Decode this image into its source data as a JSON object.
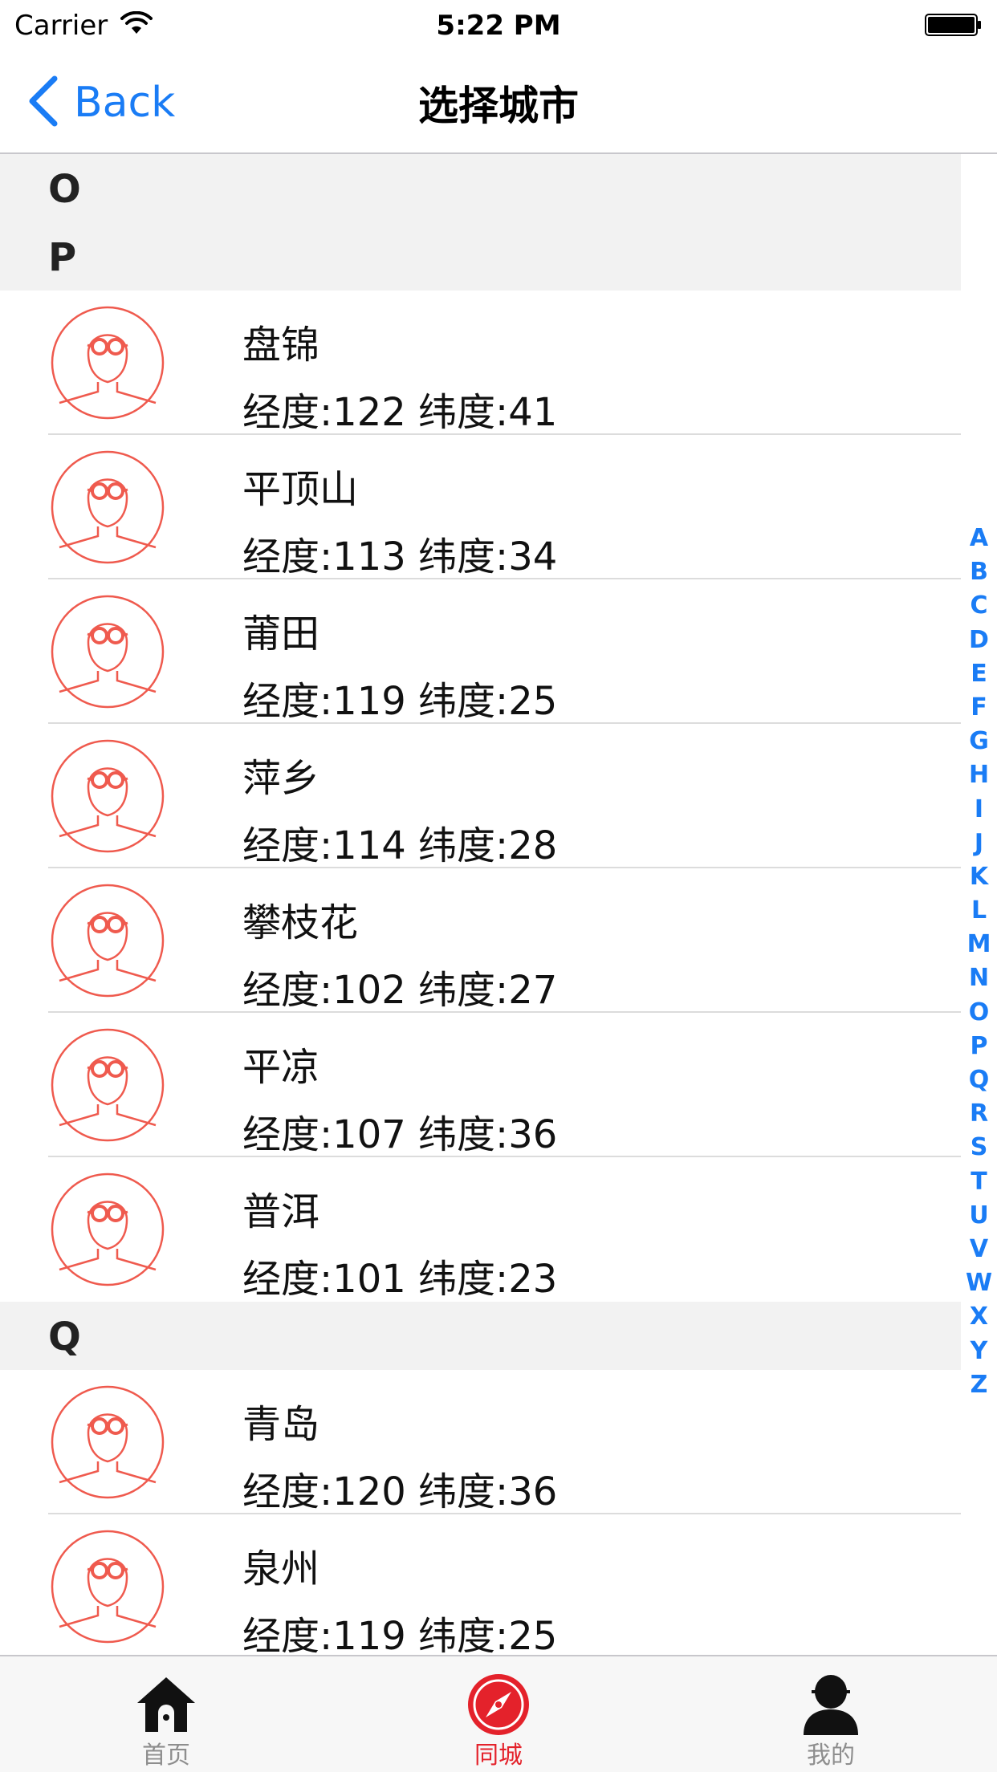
{
  "status_bar": {
    "carrier": "Carrier",
    "time": "5:22 PM"
  },
  "nav": {
    "back_label": "Back",
    "title": "选择城市"
  },
  "colors": {
    "accent": "#1a7cf5",
    "avatar_stroke": "#ef5a4e",
    "active_tab": "#e4222b",
    "section_bg": "#f2f2f2"
  },
  "list": {
    "sections": [
      {
        "letter": "O",
        "cities": []
      },
      {
        "letter": "P",
        "cities": [
          {
            "name": "盘锦",
            "coords": "经度:122 纬度:41",
            "icon": "avatar-glasses-icon"
          },
          {
            "name": "平顶山",
            "coords": "经度:113 纬度:34",
            "icon": "avatar-glasses-icon"
          },
          {
            "name": "莆田",
            "coords": "经度:119 纬度:25",
            "icon": "avatar-glasses-icon"
          },
          {
            "name": "萍乡",
            "coords": "经度:114 纬度:28",
            "icon": "avatar-glasses-icon"
          },
          {
            "name": "攀枝花",
            "coords": "经度:102 纬度:27",
            "icon": "avatar-glasses-icon"
          },
          {
            "name": "平凉",
            "coords": "经度:107 纬度:36",
            "icon": "avatar-glasses-icon"
          },
          {
            "name": "普洱",
            "coords": "经度:101 纬度:23",
            "icon": "avatar-glasses-icon"
          }
        ]
      },
      {
        "letter": "Q",
        "cities": [
          {
            "name": "青岛",
            "coords": "经度:120 纬度:36",
            "icon": "avatar-glasses-icon"
          },
          {
            "name": "泉州",
            "coords": "经度:119 纬度:25",
            "icon": "avatar-glasses-icon"
          }
        ]
      }
    ]
  },
  "index_bar": {
    "letters": [
      "A",
      "B",
      "C",
      "D",
      "E",
      "F",
      "G",
      "H",
      "I",
      "J",
      "K",
      "L",
      "M",
      "N",
      "O",
      "P",
      "Q",
      "R",
      "S",
      "T",
      "U",
      "V",
      "W",
      "X",
      "Y",
      "Z"
    ]
  },
  "tab_bar": {
    "items": [
      {
        "label": "首页",
        "icon": "home-icon",
        "active": false
      },
      {
        "label": "同城",
        "icon": "compass-icon",
        "active": true
      },
      {
        "label": "我的",
        "icon": "person-icon",
        "active": false
      }
    ]
  }
}
